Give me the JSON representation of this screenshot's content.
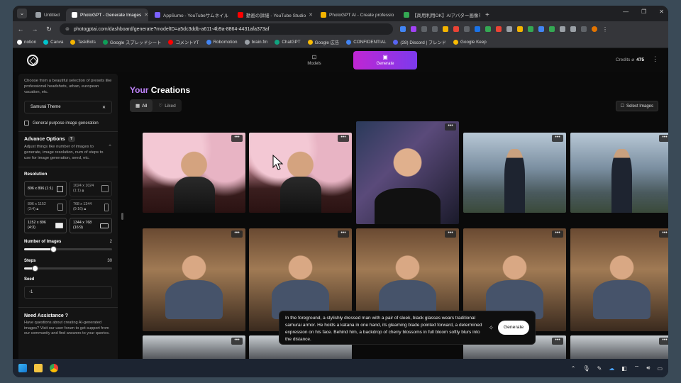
{
  "browser": {
    "tabs": [
      {
        "label": "Untitled",
        "color": "#9aa0a6"
      },
      {
        "label": "PhotoGPT - Generate Images",
        "color": "#ffffff",
        "active": true
      },
      {
        "label": "AppSumo - YouTubeサムネイル",
        "color": "#7b61ff"
      },
      {
        "label": "動画の詳細 - YouTube Studio",
        "color": "#ff0000"
      },
      {
        "label": "PhotoGPT AI - Create professio",
        "color": "#f4b400"
      },
      {
        "label": "【商用利用OK】AIアバター画像を作",
        "color": "#34a853"
      }
    ],
    "url": "photogptai.com/dashboard/generate?modelID=a5dc3ddb-a611-4b9a-8864-4431afa373af",
    "bookmarks": [
      {
        "label": "notion",
        "color": "#ffffff"
      },
      {
        "label": "Canva",
        "color": "#00c4cc"
      },
      {
        "label": "TaskBots",
        "color": "#f4b400"
      },
      {
        "label": "Google スプレッドシート",
        "color": "#0f9d58"
      },
      {
        "label": "コメントYT",
        "color": "#ff0000"
      },
      {
        "label": "Robomotion",
        "color": "#4285f4"
      },
      {
        "label": "brain.fm",
        "color": "#9aa0a6"
      },
      {
        "label": "ChatGPT",
        "color": "#10a37f"
      },
      {
        "label": "Google 広告",
        "color": "#fbbc04"
      },
      {
        "label": "CONFIDENTIAL",
        "color": "#4285f4"
      },
      {
        "label": "(28) Discord | フレンド",
        "color": "#5865f2"
      },
      {
        "label": "Google Keep",
        "color": "#fbbc04"
      }
    ]
  },
  "header": {
    "nav": [
      {
        "label": "Models",
        "icon": "box-icon"
      },
      {
        "label": "Generate",
        "icon": "image-icon",
        "active": true
      }
    ],
    "credits_label": "Credits",
    "credits_value": "475"
  },
  "sidebar": {
    "preset_desc": "Choose from a beautiful selection of presets like professional headshots, urban, european vacation, etc.",
    "theme_value": "Samurai Theme",
    "general_purpose_label": "General purpose image generation",
    "advance_title": "Advance Options",
    "advance_help": "?",
    "advance_desc": "Adjust things like number of images to generate, image resolution, num of steps to use for image generation, seed, etc.",
    "resolution_label": "Resolution",
    "resolutions": [
      {
        "line1": "896 x 896",
        "line2": "(1:1)",
        "selected": true
      },
      {
        "line1": "1024 x 1024",
        "line2": "(1:1)"
      },
      {
        "line1": "896 x 1152",
        "line2": "(3:4)"
      },
      {
        "line1": "768 x 1344",
        "line2": "(9:16)"
      },
      {
        "line1": "1152 x 896",
        "line2": "(4:3)",
        "selected": true
      },
      {
        "line1": "1344 x 768",
        "line2": "(16:9)",
        "selected": true
      }
    ],
    "num_images_label": "Number of Images",
    "num_images_value": "2",
    "num_images_fraction": 0.33,
    "steps_label": "Steps",
    "steps_value": "30",
    "steps_fraction": 0.12,
    "seed_label": "Seed",
    "seed_value": "-1",
    "assist_title": "Need Assistance ?",
    "assist_desc": "Have questions about creating AI-generated images? Visit our user forum to get support from our community and find answers to your queries."
  },
  "main": {
    "title_accent": "Your",
    "title_rest": "Creations",
    "filter_all": "All",
    "filter_liked": "Liked",
    "select_images": "Select Images",
    "more_glyph": "•••",
    "prompt_text": "In the foreground, a stylishly dressed man with a pair of sleek, black glasses wears traditional samurai armor. He holds a katana in one hand, its gleaming blade pointed forward, a determined expression on his face. Behind him, a backdrop of cherry blossoms in full bloom softly blurs into the distance.",
    "generate_button": "Generate"
  }
}
